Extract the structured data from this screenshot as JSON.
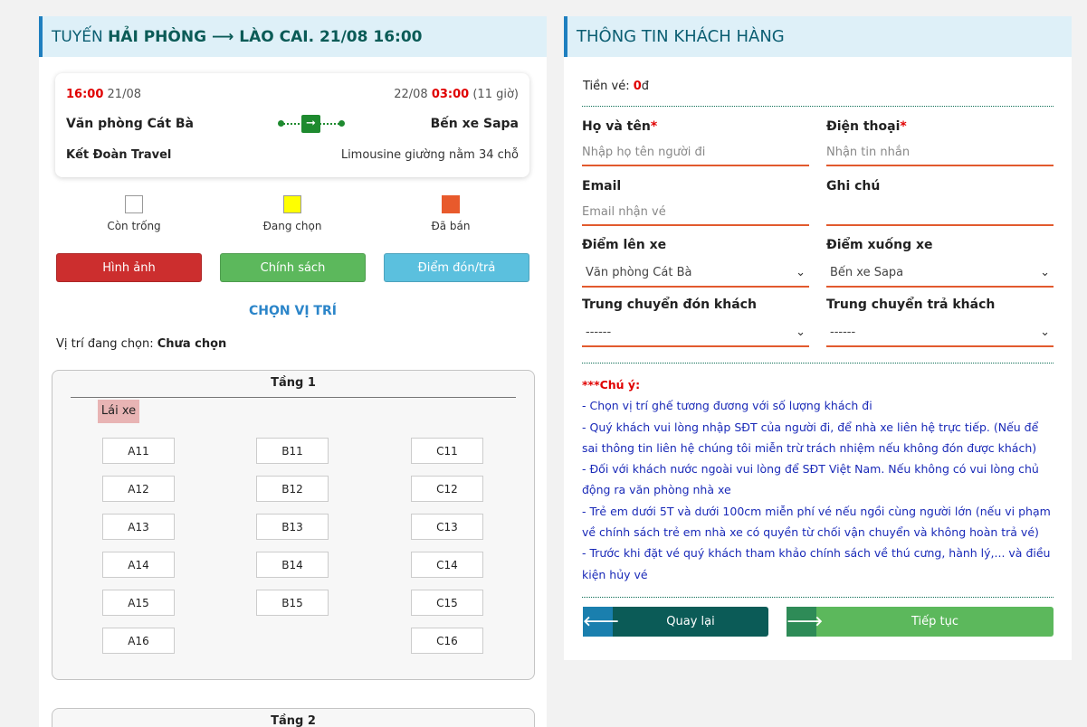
{
  "route": {
    "prefix": "TUYẾN ",
    "title_bold": "HẢI PHÒNG ⟶ LÀO CAI",
    "datetime": ". 21/08 16:00"
  },
  "trip": {
    "depart_time": "16:00",
    "depart_date": " 21/08",
    "arrive_date": "22/08 ",
    "arrive_time": "03:00",
    "duration": " (11 giờ)",
    "from": "Văn phòng Cát Bà",
    "to": "Bến xe Sapa",
    "company": "Kết Đoàn Travel",
    "vehicle": "Limousine giường nằm 34 chỗ"
  },
  "legend": [
    {
      "label": "Còn trống",
      "color": "#ffffff"
    },
    {
      "label": "Đang chọn",
      "color": "#ffff00"
    },
    {
      "label": "Đã bán",
      "color": "#e85a2c"
    }
  ],
  "buttons": {
    "images": "Hình ảnh",
    "policy": "Chính sách",
    "pickup": "Điểm đón/trả"
  },
  "seat_section": {
    "title": "CHỌN VỊ TRÍ",
    "current_label": "Vị trí đang chọn: ",
    "current_value": "Chưa chọn"
  },
  "floor1": {
    "title": "Tầng 1",
    "driver": "Lái xe",
    "col_a": [
      "A11",
      "A12",
      "A13",
      "A14",
      "A15",
      "A16"
    ],
    "col_b": [
      "B11",
      "B12",
      "B13",
      "B14",
      "B15"
    ],
    "col_c": [
      "C11",
      "C12",
      "C13",
      "C14",
      "C15",
      "C16"
    ]
  },
  "floor2": {
    "title": "Tầng 2"
  },
  "customer": {
    "title": "THÔNG TIN KHÁCH HÀNG",
    "price_label": "Tiền vé: ",
    "price_value": "0",
    "price_currency": "đ",
    "name_label": "Họ và tên",
    "name_placeholder": "Nhập họ tên người đi",
    "phone_label": "Điện thoại",
    "phone_placeholder": "Nhận tin nhắn",
    "email_label": "Email",
    "email_placeholder": "Email nhận vé",
    "note_label": "Ghi chú",
    "note_value": "",
    "pickup_label": "Điểm lên xe",
    "pickup_value": "Văn phòng Cát Bà",
    "dropoff_label": "Điểm xuống xe",
    "dropoff_value": "Bến xe Sapa",
    "transfer_pick_label": "Trung chuyển đón khách",
    "transfer_pick_value": "------",
    "transfer_drop_label": "Trung chuyển trả khách",
    "transfer_drop_value": "------",
    "required_mark": "*"
  },
  "notes": {
    "title": "***Chú ý:",
    "lines": [
      "- Chọn vị trí ghế tương đương với số lượng khách đi",
      "- Quý khách vui lòng nhập SĐT của người đi, để nhà xe liên hệ trực tiếp. (Nếu để sai thông tin liên hệ chúng tôi miễn trừ trách nhiệm nếu không đón được khách)",
      "- Đối với khách nước ngoài vui lòng để SĐT Việt Nam. Nếu không có vui lòng chủ động ra văn phòng nhà xe",
      "- Trẻ em dưới 5T và dưới 100cm miễn phí vé nếu ngồi cùng người lớn (nếu vi phạm về chính sách trẻ em nhà xe có quyền từ chối vận chuyển và không hoàn trả vé)",
      "- Trước khi đặt vé quý khách tham khảo chính sách về thú cưng, hành lý,... và điều kiện hủy vé"
    ]
  },
  "actions": {
    "back": "Quay lại",
    "next": "Tiếp tục"
  },
  "colors": {
    "accent_dark": "#0b5b57",
    "red_button": "#cc2e2e",
    "green_button": "#5cb85c",
    "blue_button": "#5bc0de",
    "input_underline": "#e25a2e"
  }
}
